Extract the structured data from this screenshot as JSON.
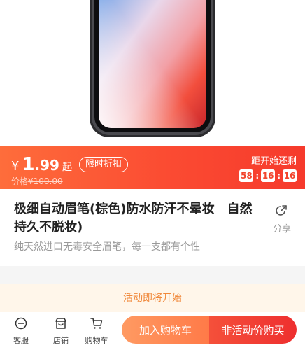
{
  "promo": {
    "currency": "¥",
    "price_integer": "1",
    "price_decimal": ".99",
    "price_suffix": "起",
    "badge": "限时折扣",
    "old_price_label": "价格",
    "old_price": "¥100.00",
    "countdown_title": "距开始还剩",
    "countdown": [
      "58",
      "16",
      "16"
    ],
    "countdown_separator": ":"
  },
  "product": {
    "title": "极细自动眉笔(棕色)防水防汗不晕妆　自然持久不脱妆)",
    "subtitle": "纯天然进口无毒安全眉笔，每一支都有个性",
    "share_label": "分享"
  },
  "activity_banner": "活动即将开始",
  "bottom_bar": {
    "nav": [
      {
        "label": "客服",
        "icon": "chat-icon"
      },
      {
        "label": "店铺",
        "icon": "store-icon"
      },
      {
        "label": "购物车",
        "icon": "cart-icon"
      }
    ],
    "add_to_cart": "加入购物车",
    "buy_now": "非活动价购买"
  },
  "colors": {
    "promo_gradient_start": "#fe6d3b",
    "promo_gradient_end": "#f63a2c",
    "banner_text": "#f0883a",
    "buy_button": "#ee2f2f"
  }
}
